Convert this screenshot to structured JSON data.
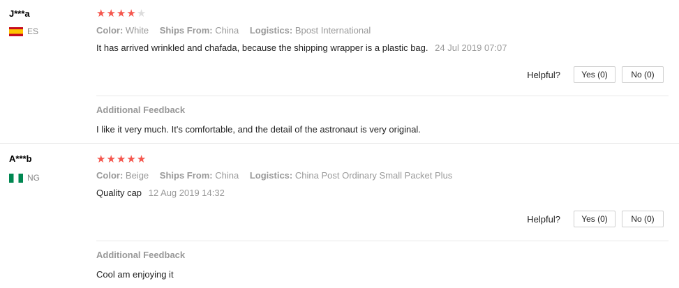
{
  "helpful_label": "Helpful?",
  "additional_feedback_label": "Additional Feedback",
  "labels": {
    "color": "Color:",
    "ships_from": "Ships From:",
    "logistics": "Logistics:"
  },
  "colors": {
    "star_on": "#f5564d",
    "star_off": "#dcdcdc"
  },
  "reviews": [
    {
      "user": "J***a",
      "country": "ES",
      "rating": 4,
      "color": "White",
      "ships_from": "China",
      "logistics": "Bpost International",
      "text": "It has arrived wrinkled and chafada, because the shipping wrapper is a plastic bag.",
      "date": "24 Jul 2019 07:07",
      "yes": "Yes (0)",
      "no": "No (0)",
      "feedback": "I like it very much. It's comfortable, and the detail of the astronaut is very original."
    },
    {
      "user": "A***b",
      "country": "NG",
      "rating": 5,
      "color": "Beige",
      "ships_from": "China",
      "logistics": "China Post Ordinary Small Packet Plus",
      "text": "Quality cap",
      "date": "12 Aug 2019 14:32",
      "yes": "Yes (0)",
      "no": "No (0)",
      "feedback": "Cool am enjoying it"
    }
  ]
}
